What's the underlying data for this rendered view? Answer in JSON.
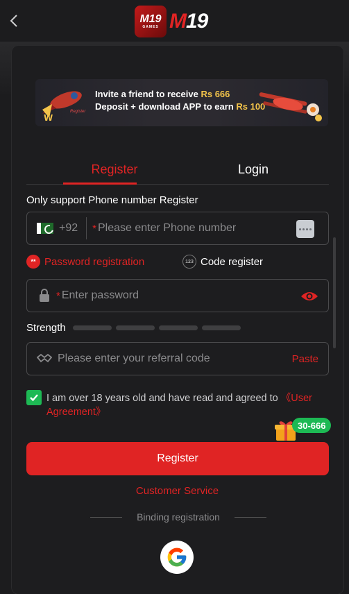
{
  "header": {
    "logo_badge": "M19",
    "logo_badge_sub": "GAMES",
    "logo_text_m": "M",
    "logo_text_19": "19"
  },
  "banner": {
    "line1_text": "Invite a friend to receive",
    "line1_amount": "Rs 666",
    "line2_text": "Deposit + download APP to earn",
    "line2_amount": "Rs 100",
    "register_tag": "Register"
  },
  "tabs": [
    {
      "label": "Register",
      "active": true
    },
    {
      "label": "Login",
      "active": false
    }
  ],
  "form": {
    "register_note": "Only support Phone number Register",
    "country_code": "+92",
    "phone_placeholder": "Please enter Phone number",
    "options": {
      "password_registration": "Password registration",
      "password_icon": "**",
      "code_register": "Code register",
      "code_icon": "123"
    },
    "password_placeholder": "Enter password",
    "strength_label": "Strength",
    "referral_placeholder": "Please enter your referral code",
    "paste_label": "Paste",
    "agree_text": "I am over 18 years old and have read and agreed to",
    "agree_link": "《User Agreement》",
    "agreed": true,
    "bonus_badge": "30-666",
    "register_button": "Register"
  },
  "footer": {
    "customer_service": "Customer Service",
    "binding_label": "Binding registration"
  },
  "colors": {
    "accent": "#e02424",
    "success": "#1db954",
    "background": "#1c1c1e"
  }
}
